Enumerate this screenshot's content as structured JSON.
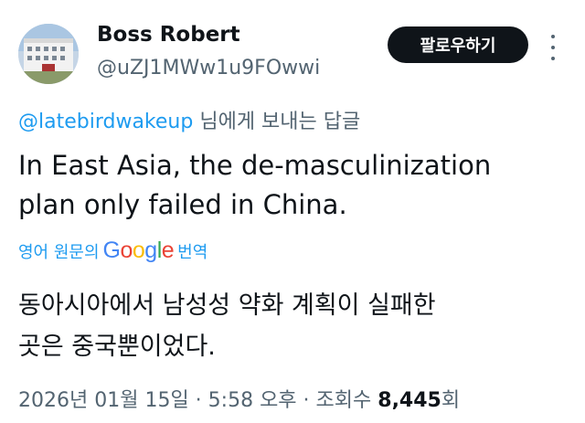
{
  "user": {
    "display_name": "Boss Robert",
    "handle": "@uZJ1MWw1u9FOwwi"
  },
  "follow_button": {
    "label": "팔로우하기"
  },
  "reply_to": {
    "mention": "@latebirdwakeup",
    "suffix": " 님에게 보내는 답글"
  },
  "tweet": {
    "line1": "In East Asia, the de-masculinization",
    "line2": "plan only failed in China."
  },
  "translation": {
    "prefix": "영어 원문의",
    "google": [
      "G",
      "o",
      "o",
      "g",
      "l",
      "e"
    ],
    "suffix": "번역",
    "line1": "동아시아에서 남성성 약화 계획이 실패한",
    "line2": "곳은 중국뿐이었다."
  },
  "meta": {
    "date": "2026년 01월 15일",
    "sep1": " · ",
    "time": "5:58 오후",
    "sep2": " · 조회수 ",
    "views": "8,445",
    "views_suffix": "회"
  },
  "colors": {
    "accent": "#1d9bf0",
    "text_primary": "#0f1419",
    "text_secondary": "#536471",
    "google": [
      "#4285F4",
      "#EA4335",
      "#FBBC05",
      "#4285F4",
      "#34A853",
      "#EA4335"
    ]
  },
  "icons": {
    "more": "more-vertical-icon"
  }
}
